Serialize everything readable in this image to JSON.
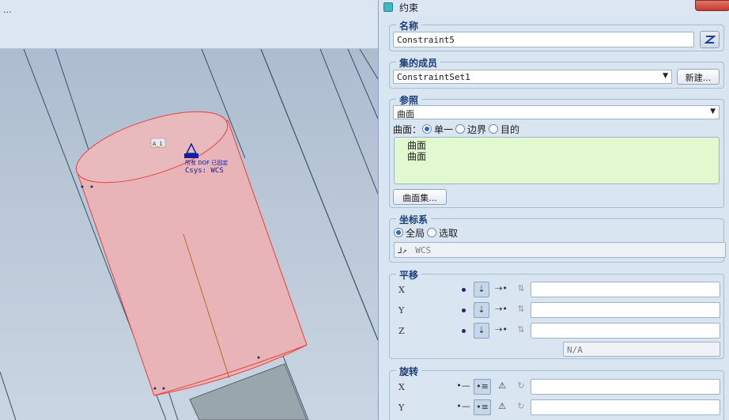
{
  "viewport": {
    "menu_text": "...",
    "model_labels": {
      "tag": "A_1",
      "dof": "所有 DOF 已固定",
      "csys": "Csys: WCS"
    }
  },
  "dialog": {
    "title": "约束",
    "name_group": {
      "legend": "名称",
      "value": "Constraint5"
    },
    "set_group": {
      "legend": "集的成员",
      "value": "ConstraintSet1",
      "new_button": "新建..."
    },
    "ref_group": {
      "legend": "参照",
      "type_value": "曲面",
      "selector_label": "曲面：",
      "options": [
        "单一",
        "边界",
        "目的"
      ],
      "selected_option": "单一",
      "references": [
        "曲面",
        "曲面"
      ],
      "surface_set_button": "曲面集..."
    },
    "csys_group": {
      "legend": "坐标系",
      "options": [
        "全局",
        "选取"
      ],
      "selected_option": "全局",
      "csys_value": "WCS"
    },
    "translation_group": {
      "legend": "平移",
      "axes": [
        "X",
        "Y",
        "Z"
      ],
      "na_value": "N/A"
    },
    "rotation_group": {
      "legend": "旋转",
      "axes": [
        "X",
        "Y"
      ]
    }
  },
  "colors": {
    "legend": "#1b3f78",
    "ref_box": "#e2f8cf",
    "cylinder": "#e8b4b8",
    "edge": "#e8403a"
  }
}
